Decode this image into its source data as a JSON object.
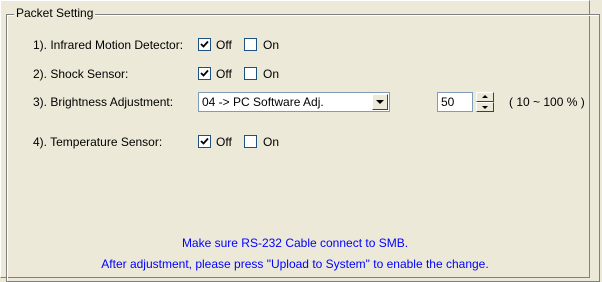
{
  "group_title": "Packet Setting",
  "items": [
    {
      "label": "1). Infrared Motion Detector:",
      "off_label": "Off",
      "on_label": "On",
      "off_checked": true,
      "on_checked": false
    },
    {
      "label": "2). Shock Sensor:",
      "off_label": "Off",
      "on_label": "On",
      "off_checked": true,
      "on_checked": false
    },
    {
      "label": "4). Temperature Sensor:",
      "off_label": "Off",
      "on_label": "On",
      "off_checked": true,
      "on_checked": false
    }
  ],
  "brightness": {
    "label": "3). Brightness Adjustment:",
    "selected": "04 -> PC Software Adj.",
    "value": "50",
    "range_text": "( 10 ~ 100 % )"
  },
  "notes": {
    "line1": "Make sure RS-232 Cable connect to SMB.",
    "line2": "After adjustment, please press \"Upload to System\" to enable the change."
  },
  "colors": {
    "background": "#ece9d8",
    "note_text": "#0000ff",
    "checkbox_border": "#1c5180"
  }
}
